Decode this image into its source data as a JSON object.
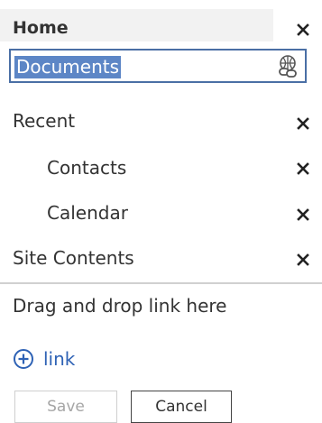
{
  "nav": {
    "items": [
      {
        "label": "Home",
        "bold": true
      },
      {
        "label": "Documents",
        "editing": true
      },
      {
        "label": "Recent"
      },
      {
        "label": "Contacts",
        "indent": true
      },
      {
        "label": "Calendar",
        "indent": true
      },
      {
        "label": "Site Contents"
      }
    ]
  },
  "drop_zone": {
    "text": "Drag and drop link here"
  },
  "add_link": {
    "label": "link",
    "icon": "plus-circle-icon"
  },
  "buttons": {
    "save": "Save",
    "cancel": "Cancel"
  },
  "colors": {
    "accent": "#2e62b5",
    "selection": "#5d86c6"
  }
}
